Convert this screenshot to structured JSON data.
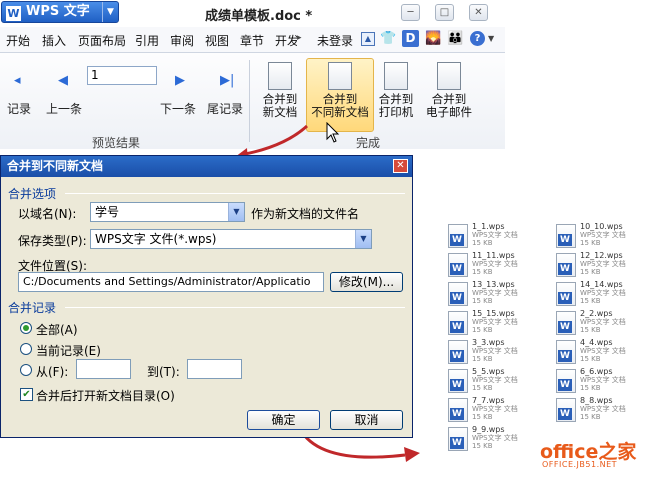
{
  "app": {
    "name": "WPS 文字",
    "logo": "W",
    "doc_title": "成绩单模板.doc *"
  },
  "window_buttons": [
    "minimize-icon",
    "restore-icon",
    "close-icon"
  ],
  "menu": {
    "items": [
      "开始",
      "插入",
      "页面布局",
      "引用",
      "审阅",
      "视图",
      "章节",
      "开发"
    ],
    "login": "未登录"
  },
  "ribbon": {
    "first_record": "记录",
    "prev_record": "上一条",
    "page_value": "1",
    "next_record": "下一条",
    "last_record": "尾记录",
    "preview_group": "预览结果",
    "merge_new": [
      "合并到",
      "新文档"
    ],
    "merge_diff": [
      "合并到",
      "不同新文档"
    ],
    "merge_printer": [
      "合并到",
      "打印机"
    ],
    "merge_email": [
      "合并到",
      "电子邮件"
    ],
    "finish_group": "完成"
  },
  "dialog": {
    "title": "合并到不同新文档",
    "section_options": "合并选项",
    "domain_label": "以域名(N):",
    "domain_value": "学号",
    "domain_hint": "作为新文档的文件名",
    "type_label": "保存类型(P):",
    "type_value": "WPS文字 文件(*.wps)",
    "location_label": "文件位置(S):",
    "location_value": "C:/Documents and Settings/Administrator/Applicatio",
    "modify_button": "修改(M)...",
    "section_records": "合并记录",
    "radio_all": "全部(A)",
    "radio_current": "当前记录(E)",
    "radio_from": "从(F):",
    "radio_to": "到(T):",
    "checkbox_open": "合并后打开新文档目录(O)",
    "ok_button": "确定",
    "cancel_button": "取消"
  },
  "files": [
    {
      "name": "1_1.wps",
      "sub": "WPS文字 文档",
      "size": "15 KB"
    },
    {
      "name": "10_10.wps",
      "sub": "WPS文字 文档",
      "size": "15 KB"
    },
    {
      "name": "11_11.wps",
      "sub": "WPS文字 文档",
      "size": "15 KB"
    },
    {
      "name": "12_12.wps",
      "sub": "WPS文字 文档",
      "size": "15 KB"
    },
    {
      "name": "13_13.wps",
      "sub": "WPS文字 文档",
      "size": "15 KB"
    },
    {
      "name": "14_14.wps",
      "sub": "WPS文字 文档",
      "size": "15 KB"
    },
    {
      "name": "15_15.wps",
      "sub": "WPS文字 文档",
      "size": "15 KB"
    },
    {
      "name": "2_2.wps",
      "sub": "WPS文字 文档",
      "size": "15 KB"
    },
    {
      "name": "3_3.wps",
      "sub": "WPS文字 文档",
      "size": "15 KB"
    },
    {
      "name": "4_4.wps",
      "sub": "WPS文字 文档",
      "size": "15 KB"
    },
    {
      "name": "5_5.wps",
      "sub": "WPS文字 文档",
      "size": "15 KB"
    },
    {
      "name": "6_6.wps",
      "sub": "WPS文字 文档",
      "size": "15 KB"
    },
    {
      "name": "7_7.wps",
      "sub": "WPS文字 文档",
      "size": "15 KB"
    },
    {
      "name": "8_8.wps",
      "sub": "WPS文字 文档",
      "size": "15 KB"
    },
    {
      "name": "9_9.wps",
      "sub": "WPS文字 文档",
      "size": "15 KB"
    }
  ],
  "watermark": {
    "brand": "office之家",
    "url": "OFFICE.JB51.NET"
  },
  "colors": {
    "accent": "#1f5fc4",
    "arrow": "#c0282a",
    "highlight": "#ffd87a",
    "dialog_bg": "#ece9d8"
  }
}
